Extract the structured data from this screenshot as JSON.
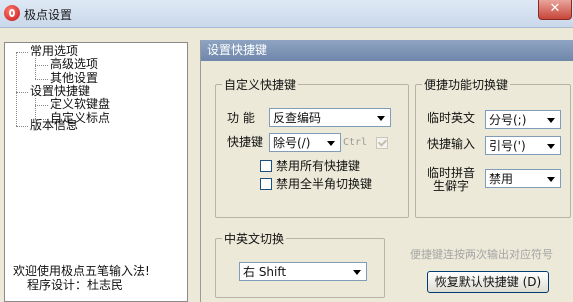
{
  "window": {
    "title": "极点设置",
    "close_glyph": "✕"
  },
  "tree": {
    "items": [
      {
        "label": "常用选项"
      },
      {
        "label": "高级选项"
      },
      {
        "label": "其他设置"
      },
      {
        "label": "设置快捷键"
      },
      {
        "label": "定义软键盘"
      },
      {
        "label": "自定义标点"
      },
      {
        "label": "版本信息"
      }
    ]
  },
  "welcome": {
    "line1": "欢迎使用极点五笔输入法!",
    "line2": "程序设计：杜志民"
  },
  "panel": {
    "header": "设置快捷键",
    "custom": {
      "legend": "自定义快捷键",
      "function_label": "功  能",
      "function_value": "反查编码",
      "shortcut_label": "快捷键",
      "shortcut_value": "除号(/)",
      "ctrl_label": "Ctrl",
      "disable_all_label": "禁用所有快捷键",
      "disable_fullhalf_label": "禁用全半角切换键"
    },
    "toggle": {
      "legend": "便捷功能切换键",
      "temp_english_label": "临时英文",
      "temp_english_value": "分号(;)",
      "quick_input_label": "快捷输入",
      "quick_input_value": "引号(')",
      "temp_pinyin_label1": "临时拼音",
      "temp_pinyin_label2": "生僻字",
      "temp_pinyin_value": "禁用"
    },
    "cn_en": {
      "legend": "中英文切换",
      "value": "右 Shift"
    },
    "hint": "便捷键连按两次输出对应符号",
    "restore_button": "恢复默认快捷键 (D)"
  }
}
